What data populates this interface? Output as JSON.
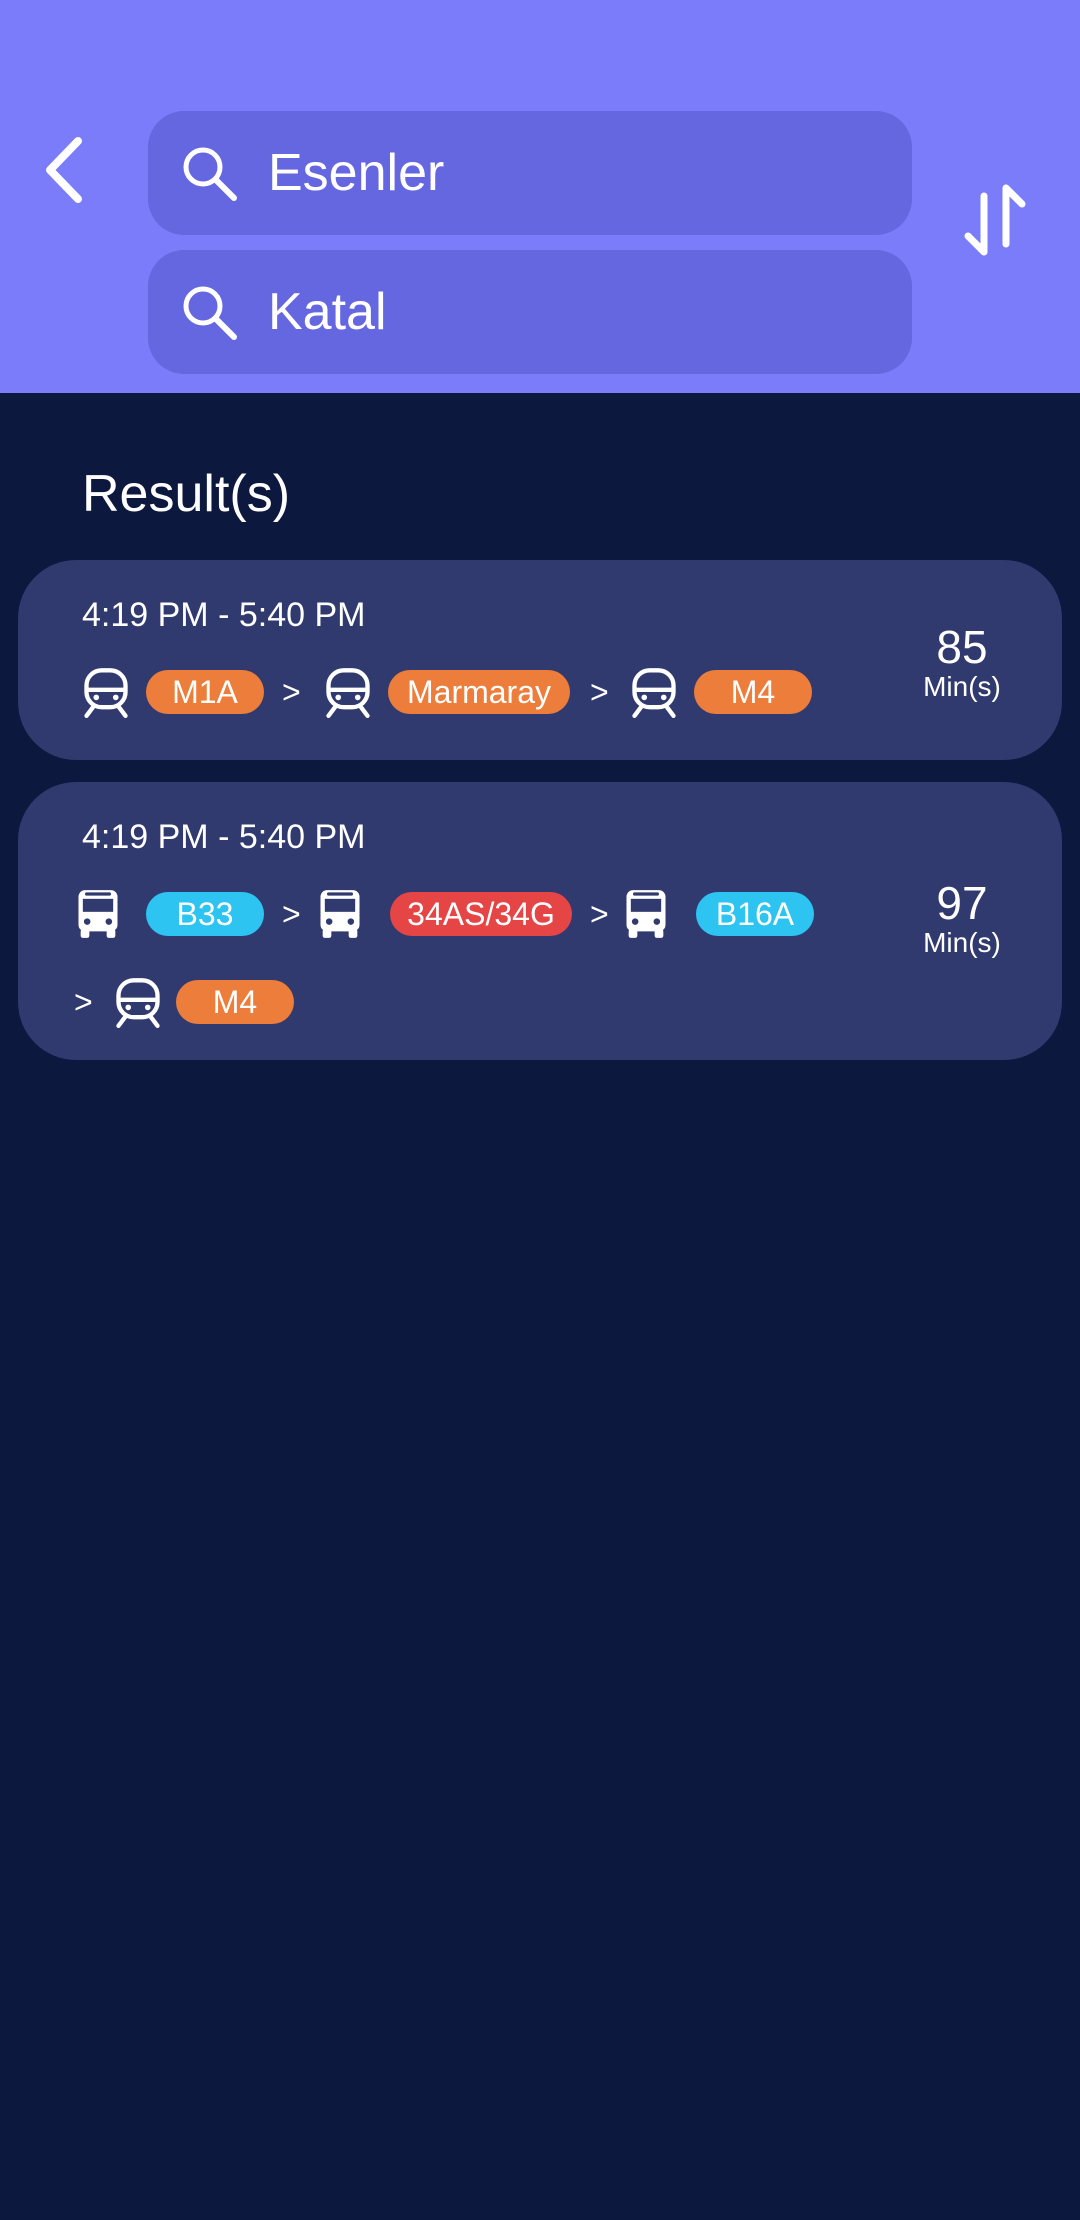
{
  "header": {
    "from_value": "Esenler",
    "to_value": "Katal",
    "back_icon": "chevron-left-icon",
    "swap_icon": "swap-vertical-icon",
    "search_icon": "search-icon"
  },
  "results_title": "Result(s)",
  "colors": {
    "header_bg": "#7a7cfa",
    "search_bg": "#6567e0",
    "page_bg": "#0c183d",
    "card_bg": "#313a6e",
    "metro_badge": "#ec7d3a",
    "bus_badge": "#2ec4f2",
    "express_badge": "#e64545"
  },
  "routes": [
    {
      "time": "4:19 PM - 5:40 PM",
      "duration": "85",
      "unit": "Min(s)",
      "legs": [
        {
          "icon": "tram-icon",
          "label": "M1A",
          "color": "orange"
        },
        {
          "icon": "tram-icon",
          "label": "Marmaray",
          "color": "orange"
        },
        {
          "icon": "tram-icon",
          "label": "M4",
          "color": "orange"
        }
      ]
    },
    {
      "time": "4:19 PM - 5:40 PM",
      "duration": "97",
      "unit": "Min(s)",
      "legs": [
        {
          "icon": "bus-icon",
          "label": "B33",
          "color": "cyan"
        },
        {
          "icon": "bus-icon",
          "label": "34AS/34G",
          "color": "red"
        },
        {
          "icon": "bus-icon",
          "label": "B16A",
          "color": "cyan"
        },
        {
          "icon": "tram-icon",
          "label": "M4",
          "color": "orange"
        }
      ]
    }
  ],
  "separator": ">"
}
